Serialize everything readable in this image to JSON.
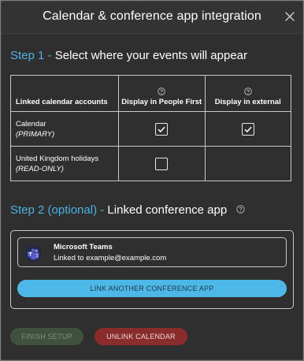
{
  "dialog": {
    "title": "Calendar & conference app integration",
    "close_icon": "close-icon"
  },
  "step1": {
    "label": "Step 1",
    "separator": " - ",
    "text": "Select where your events will appear"
  },
  "table": {
    "headers": {
      "accounts": "Linked calendar accounts",
      "people_first": "Display in People First",
      "external": "Display in external"
    },
    "rows": [
      {
        "name": "Calendar",
        "sub": "(PRIMARY)",
        "people_first": true,
        "external": true,
        "external_visible": true
      },
      {
        "name": "United Kingdom holidays",
        "sub": "(READ-ONLY)",
        "people_first": false,
        "external": false,
        "external_visible": false
      }
    ]
  },
  "step2": {
    "label": "Step 2 (optional)",
    "separator": " - ",
    "text": "Linked conference app"
  },
  "conference": {
    "app_name": "Microsoft Teams",
    "linked_to": "Linked to example@example.com",
    "icon": "microsoft-teams-icon",
    "link_button": "LINK ANOTHER CONFERENCE APP"
  },
  "footer": {
    "finish_label": "FINISH SETUP",
    "unlink_label": "UNLINK CALENDAR"
  },
  "colors": {
    "accent": "#4db2e3",
    "link_button": "#4db8e8",
    "finish_disabled": "#3f523d",
    "unlink": "#8a2c2c"
  }
}
